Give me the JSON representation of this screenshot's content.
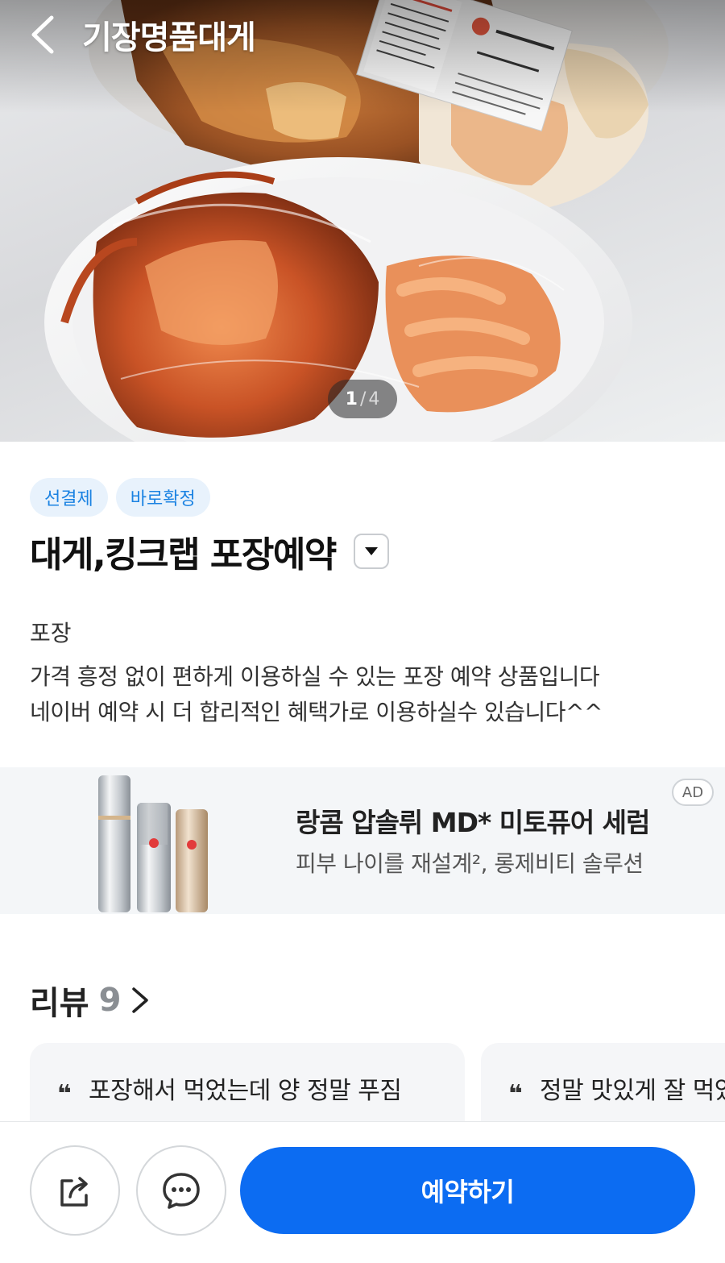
{
  "header": {
    "title": "기장명품대게",
    "photo_counter": {
      "current": "1",
      "separator": "/",
      "total": "4"
    }
  },
  "product": {
    "tags": [
      "선결제",
      "바로확정"
    ],
    "title": "대게,킹크랩 포장예약",
    "category": "포장",
    "description_lines": [
      "가격 흥정 없이 편하게 이용하실 수 있는 포장 예약 상품입니다",
      "네이버 예약 시 더 합리적인 혜택가로 이용하실수 있습니다^^"
    ]
  },
  "ad": {
    "headline": "랑콤 압솔뤼 MD* 미토퓨어 세럼",
    "subline": "피부 나이를 재설계², 롱제비티 솔루션",
    "badge": "AD"
  },
  "reviews": {
    "label": "리뷰",
    "count": "9",
    "cards": [
      {
        "quote": "❝",
        "text": "포장해서 먹었는데 양 정말 푸짐"
      },
      {
        "quote": "❝",
        "text": "정말 맛있게 잘 먹었"
      }
    ]
  },
  "bottom": {
    "reserve_label": "예약하기"
  },
  "colors": {
    "accent": "#0c6cf2",
    "tag_text": "#1a82e2",
    "tag_bg": "#e8f2fc"
  },
  "icons": {
    "back": "chevron-left-icon",
    "dropdown": "caret-down-icon",
    "review_more": "chevron-right-icon",
    "share": "share-icon",
    "chat": "chat-bubble-icon"
  }
}
